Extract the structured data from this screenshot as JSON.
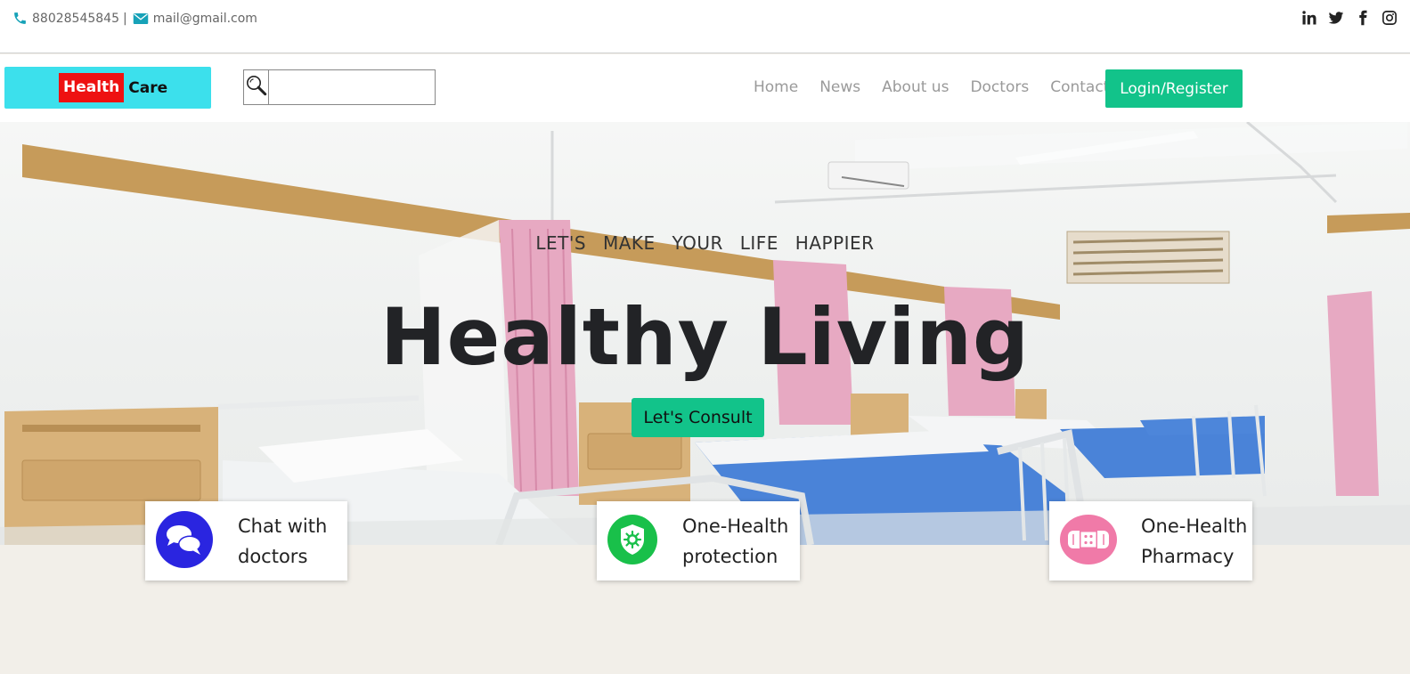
{
  "topbar": {
    "phone": "88028545845",
    "separator": "|",
    "email": "mail@gmail.com",
    "social_icons": [
      "linkedin-icon",
      "twitter-icon",
      "facebook-icon",
      "instagram-icon"
    ]
  },
  "brand": {
    "word1": "Health",
    "word2": "Care"
  },
  "search": {
    "value": "",
    "placeholder": ""
  },
  "nav": {
    "items": [
      {
        "label": "Home"
      },
      {
        "label": "News"
      },
      {
        "label": "About us"
      },
      {
        "label": "Doctors"
      },
      {
        "label": "Contact"
      }
    ],
    "login_label": "Login/Register"
  },
  "hero": {
    "tagline": "LET'S MAKE YOUR LIFE HAPPIER",
    "headline": "Healthy Living",
    "cta_label": "Let's Consult"
  },
  "features": [
    {
      "line1": "Chat with",
      "line2": "doctors",
      "icon": "chat-icon"
    },
    {
      "line1": "One-Health",
      "line2": "protection",
      "icon": "shield-virus-icon"
    },
    {
      "line1": "One-Health",
      "line2": "Pharmacy",
      "icon": "pharmacy-icon"
    }
  ],
  "colors": {
    "accent_green": "#12c38a",
    "logo_bg": "#3ce0ec",
    "logo_red": "#ee1111",
    "chat_icon": "#2a25e0",
    "shield_icon": "#19c04a",
    "pharmacy_icon": "#f07aa8",
    "page_bg": "#f2efe9"
  }
}
